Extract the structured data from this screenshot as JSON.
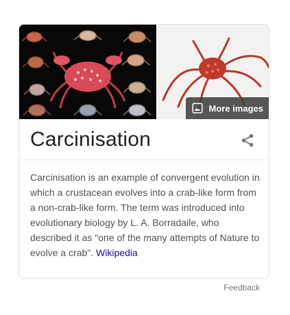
{
  "card": {
    "title": "Carcinisation",
    "more_images_label": "More images",
    "description": "Carcinisation is an example of convergent evolution in which a crustacean evolves into a crab-like form from a non-crab-like form. The term was introduced into evolutionary biology by L. A. Borradaile, who described it as \"one of the many attempts of Nature to evolve a crab\".",
    "source_link": "Wikipedia"
  },
  "footer": {
    "feedback_label": "Feedback"
  }
}
